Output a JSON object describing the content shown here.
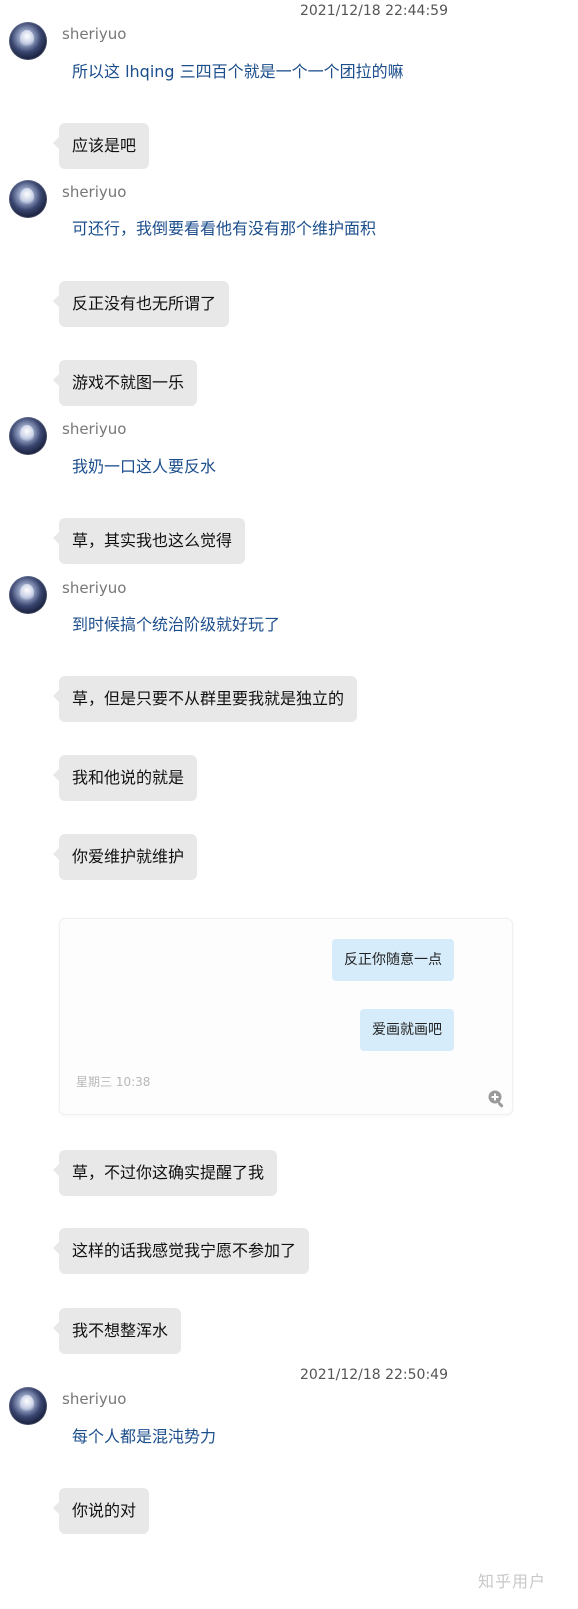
{
  "timestamps": [
    "2021/12/18 22:44:59",
    "2021/12/18 22:50:49"
  ],
  "other_user": {
    "name": "sheriyuo"
  },
  "messages": {
    "t1": "所以这 lhqing 三四百个就是一个一个团拉的嘛",
    "m1": "应该是吧",
    "t2": "可还行，我倒要看看他有没有那个维护面积",
    "m2": "反正没有也无所谓了",
    "m3": "游戏不就图一乐",
    "t3": "我奶一口这人要反水",
    "m4": "草，其实我也这么觉得",
    "t4": "到时候搞个统治阶级就好玩了",
    "m5": "草，但是只要不从群里要我就是独立的",
    "m6": "我和他说的就是",
    "m7": "你爱维护就维护",
    "m8": "草，不过你这确实提醒了我",
    "m9": "这样的话我感觉我宁愿不参加了",
    "m10": "我不想整浑水",
    "t5": "每个人都是混沌势力",
    "m11": "你说的对"
  },
  "embedded_screenshot": {
    "bubble1": "反正你随意一点",
    "bubble2": "爱画就画吧",
    "time": "星期三  10:38",
    "icon": "zoom-in-icon"
  },
  "watermark": "知乎用户",
  "colors": {
    "their_text": "#1c4e8c",
    "bubble_bg": "#e8e8e8",
    "embed_bubble_bg": "#d6ecfb"
  }
}
